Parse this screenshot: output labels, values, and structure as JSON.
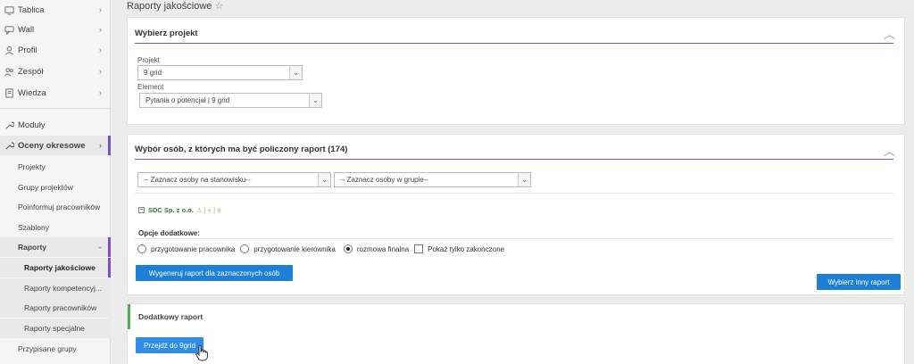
{
  "sidebar": {
    "main_items": [
      {
        "label": "Tablica",
        "icon": "monitor-icon",
        "chevron": "›"
      },
      {
        "label": "Wall",
        "icon": "chat-icon",
        "chevron": "›"
      },
      {
        "label": "Profil",
        "icon": "user-icon",
        "chevron": "›"
      },
      {
        "label": "Zespół",
        "icon": "team-icon",
        "chevron": "›"
      },
      {
        "label": "Wiedza",
        "icon": "book-icon",
        "chevron": "›"
      }
    ],
    "moduly": {
      "label": "Moduły",
      "icon": "wrench-icon"
    },
    "oceny": {
      "label": "Oceny okresowe",
      "icon": "wrench-icon",
      "chevron": "›"
    },
    "sub_items": [
      "Projekty",
      "Grupy projektów",
      "Poinformuj pracowników",
      "Szablony"
    ],
    "raporty": {
      "label": "Raporty",
      "chevron": "›"
    },
    "raporty_items": [
      "Raporty jakościowe",
      "Raporty kompetencyj...",
      "Raporty pracowników",
      "Raporty specjalne"
    ],
    "przypisane": "Przypisane grupy"
  },
  "page": {
    "title": "Raporty jakościowe",
    "star": "☆"
  },
  "project_panel": {
    "header": "Wybierz projekt",
    "collapse": "︿",
    "project_label": "Projekt",
    "project_value": "9 grid",
    "element_label": "Element",
    "element_value": "Pytania o potencjał | 9 grid"
  },
  "persons_panel": {
    "header": "Wybór osób, z których ma być policzony raport (174)",
    "collapse": "︿",
    "select_position": "-- Zaznacz osoby na stanowisku--",
    "select_group": "-- Zaznacz osoby w grupie--",
    "tree_toggle": "−",
    "tree_company": "SDC Sp. z o.o.",
    "tree_tools": "⚠ | + |",
    "tree_tools_x": "×",
    "options_label": "Opcje dodatkowe:",
    "options": {
      "opt1": "przygotowanie pracownika",
      "opt2": "przygotowanie kierownika",
      "opt3": "rozmowa finalna",
      "opt4": "Pokaż tylko zakończone"
    },
    "generate_button": "Wygeneruj raport dla zaznaczonych osób",
    "other_button": "Wybierz inny raport"
  },
  "extra_panel": {
    "title": "Dodatkowy raport",
    "button": "Przejdź do 9grid"
  },
  "colors": {
    "accent": "#7b50c8",
    "primary_button": "#1e7fd6",
    "success": "#4caf50"
  }
}
